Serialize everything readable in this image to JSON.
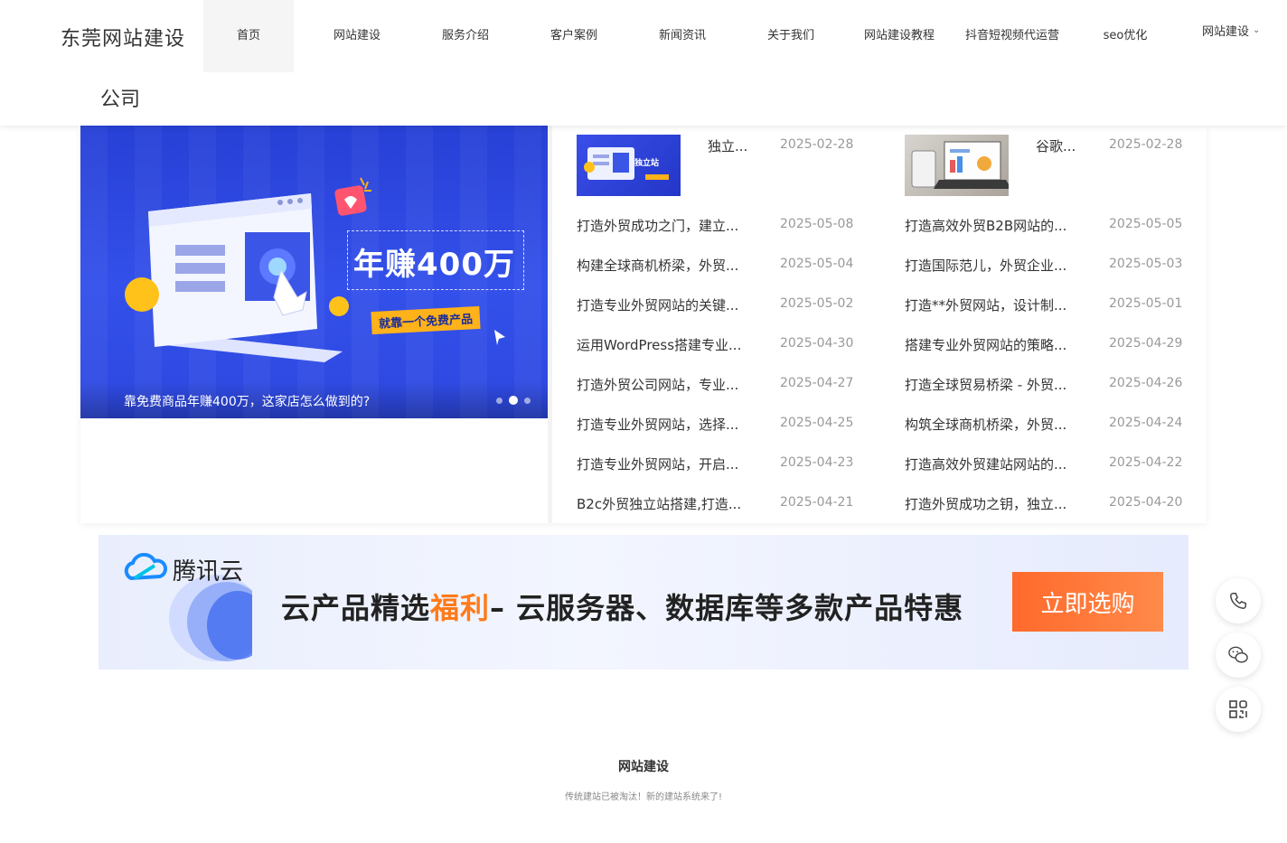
{
  "header": {
    "logo_line1": "东莞网站建设",
    "logo_line2": "公司",
    "nav": [
      {
        "label": "首页"
      },
      {
        "label": "网站建设"
      },
      {
        "label": "服务介绍"
      },
      {
        "label": "客户案例"
      },
      {
        "label": "新闻资讯"
      },
      {
        "label": "关于我们"
      },
      {
        "label": "网站建设教程"
      },
      {
        "label": "抖音短视频代运营"
      },
      {
        "label": "seo优化"
      }
    ],
    "more_label": "网站建设"
  },
  "banner": {
    "headline": "年赚400万",
    "tag": "就靠一个免费产品",
    "caption": "靠免费商品年赚400万，这家店怎么做到的?"
  },
  "news": {
    "left_thumb": {
      "title": "独立...",
      "date": "2025-02-28",
      "image_label": "独立站"
    },
    "right_thumb": {
      "title": "谷歌...",
      "date": "2025-02-28"
    },
    "left": [
      {
        "title": "打造外贸成功之门，建立...",
        "date": "2025-05-08"
      },
      {
        "title": "构建全球商机桥梁，外贸...",
        "date": "2025-05-04"
      },
      {
        "title": "打造专业外贸网站的关键...",
        "date": "2025-05-02"
      },
      {
        "title": "运用WordPress搭建专业...",
        "date": "2025-04-30"
      },
      {
        "title": "打造外贸公司网站，专业...",
        "date": "2025-04-27"
      },
      {
        "title": "打造专业外贸网站，选择...",
        "date": "2025-04-25"
      },
      {
        "title": "打造专业外贸网站，开启...",
        "date": "2025-04-23"
      },
      {
        "title": "B2c外贸独立站搭建,打造...",
        "date": "2025-04-21"
      }
    ],
    "right": [
      {
        "title": "打造高效外贸B2B网站的...",
        "date": "2025-05-05"
      },
      {
        "title": "打造国际范儿，外贸企业...",
        "date": "2025-05-03"
      },
      {
        "title": "打造**外贸网站，设计制...",
        "date": "2025-05-01"
      },
      {
        "title": "搭建专业外贸网站的策略...",
        "date": "2025-04-29"
      },
      {
        "title": "打造全球贸易桥梁 - 外贸...",
        "date": "2025-04-26"
      },
      {
        "title": "构筑全球商机桥梁，外贸...",
        "date": "2025-04-24"
      },
      {
        "title": "打造高效外贸建站网站的...",
        "date": "2025-04-22"
      },
      {
        "title": "打造外贸成功之钥，独立...",
        "date": "2025-04-20"
      }
    ]
  },
  "ad": {
    "brand": "腾讯云",
    "text_a": "云产品精选",
    "text_hl": "福利",
    "text_b": "– 云服务器、数据库等多款产品特惠",
    "button": "立即选购",
    "accent": "#ff7a1a"
  },
  "float": {
    "icons": [
      "phone-icon",
      "wechat-icon",
      "qrcode-icon"
    ]
  },
  "section": {
    "title": "网站建设",
    "subtitle": "传统建站已被淘汰！新的建站系统来了!"
  }
}
